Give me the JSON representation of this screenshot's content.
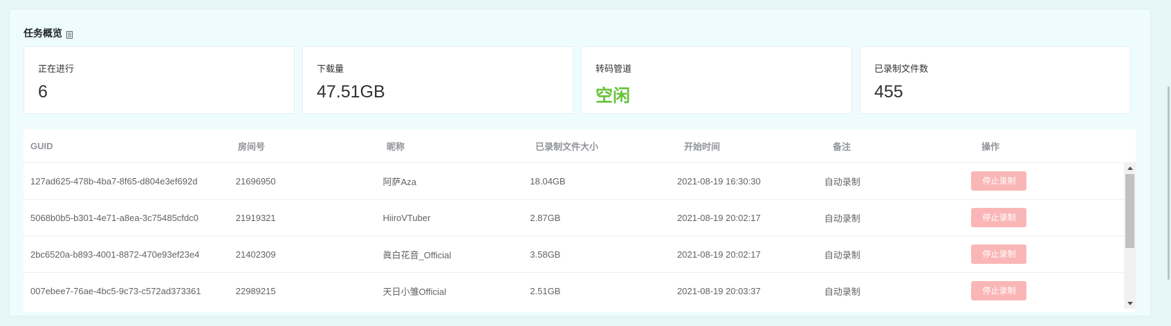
{
  "section": {
    "title": "任务概览",
    "title_icon": "document-icon"
  },
  "stats": [
    {
      "label": "正在进行",
      "value": "6"
    },
    {
      "label": "下载量",
      "value": "47.51GB"
    },
    {
      "label": "转码管道",
      "value": "空闲",
      "value_color": "#67c23a"
    },
    {
      "label": "已录制文件数",
      "value": "455"
    }
  ],
  "table": {
    "columns": [
      "GUID",
      "房间号",
      "昵称",
      "已录制文件大小",
      "开始时间",
      "备注",
      "操作"
    ],
    "rows": [
      {
        "guid": "127ad625-478b-4ba7-8f65-d804e3ef692d",
        "room": "21696950",
        "nickname": "阿萨Aza",
        "size": "18.04GB",
        "start": "2021-08-19 16:30:30",
        "note": "自动录制",
        "action": "停止录制"
      },
      {
        "guid": "5068b0b5-b301-4e71-a8ea-3c75485cfdc0",
        "room": "21919321",
        "nickname": "HiiroVTuber",
        "size": "2.87GB",
        "start": "2021-08-19 20:02:17",
        "note": "自动录制",
        "action": "停止录制"
      },
      {
        "guid": "2bc6520a-b893-4001-8872-470e93ef23e4",
        "room": "21402309",
        "nickname": "眞白花音_Official",
        "size": "3.58GB",
        "start": "2021-08-19 20:02:17",
        "note": "自动录制",
        "action": "停止录制"
      },
      {
        "guid": "007ebee7-76ae-4bc5-9c73-c572ad373361",
        "room": "22989215",
        "nickname": "天日小雏Official",
        "size": "2.51GB",
        "start": "2021-08-19 20:03:37",
        "note": "自动录制",
        "action": "停止录制"
      }
    ]
  },
  "colors": {
    "accent_green": "#67c23a",
    "danger_light": "#fab6b6",
    "page_bg": "#e7f6f9"
  }
}
